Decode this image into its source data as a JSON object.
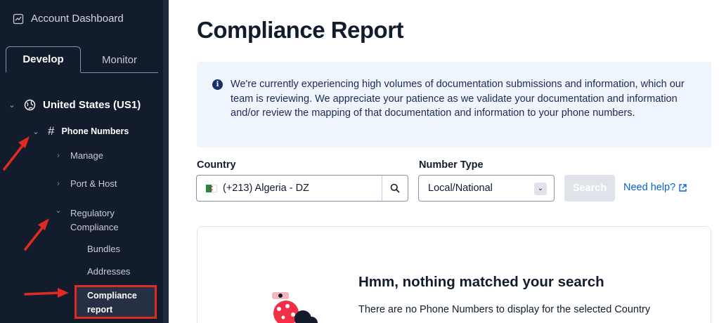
{
  "sidebar": {
    "account_dashboard": "Account Dashboard",
    "tabs": [
      {
        "label": "Develop",
        "active": true
      },
      {
        "label": "Monitor",
        "active": false
      }
    ],
    "region": "United States (US1)",
    "phone_numbers": "Phone Numbers",
    "manage": "Manage",
    "port_host": "Port & Host",
    "regulatory_line1": "Regulatory",
    "regulatory_line2": "Compliance",
    "bundles": "Bundles",
    "addresses": "Addresses",
    "compliance_line1": "Compliance",
    "compliance_line2": "report"
  },
  "main": {
    "title": "Compliance Report",
    "notice": "We're currently experiencing high volumes of documentation submissions and information, which our team is reviewing. We appreciate your patience as we validate your documentation and information and/or review the mapping of that documentation and information to your phone numbers.",
    "country_label": "Country",
    "country_value": "(+213) Algeria - DZ",
    "number_type_label": "Number Type",
    "number_type_value": "Local/National",
    "search_label": "Search",
    "help_label": "Need help?",
    "empty_title": "Hmm, nothing matched your search",
    "empty_desc": "There are no Phone Numbers to display for the selected Country"
  },
  "colors": {
    "sidebar_bg": "#121c2d",
    "link": "#0263e0",
    "highlight_border": "#e02a22",
    "notice_bg": "#eef5fd"
  }
}
